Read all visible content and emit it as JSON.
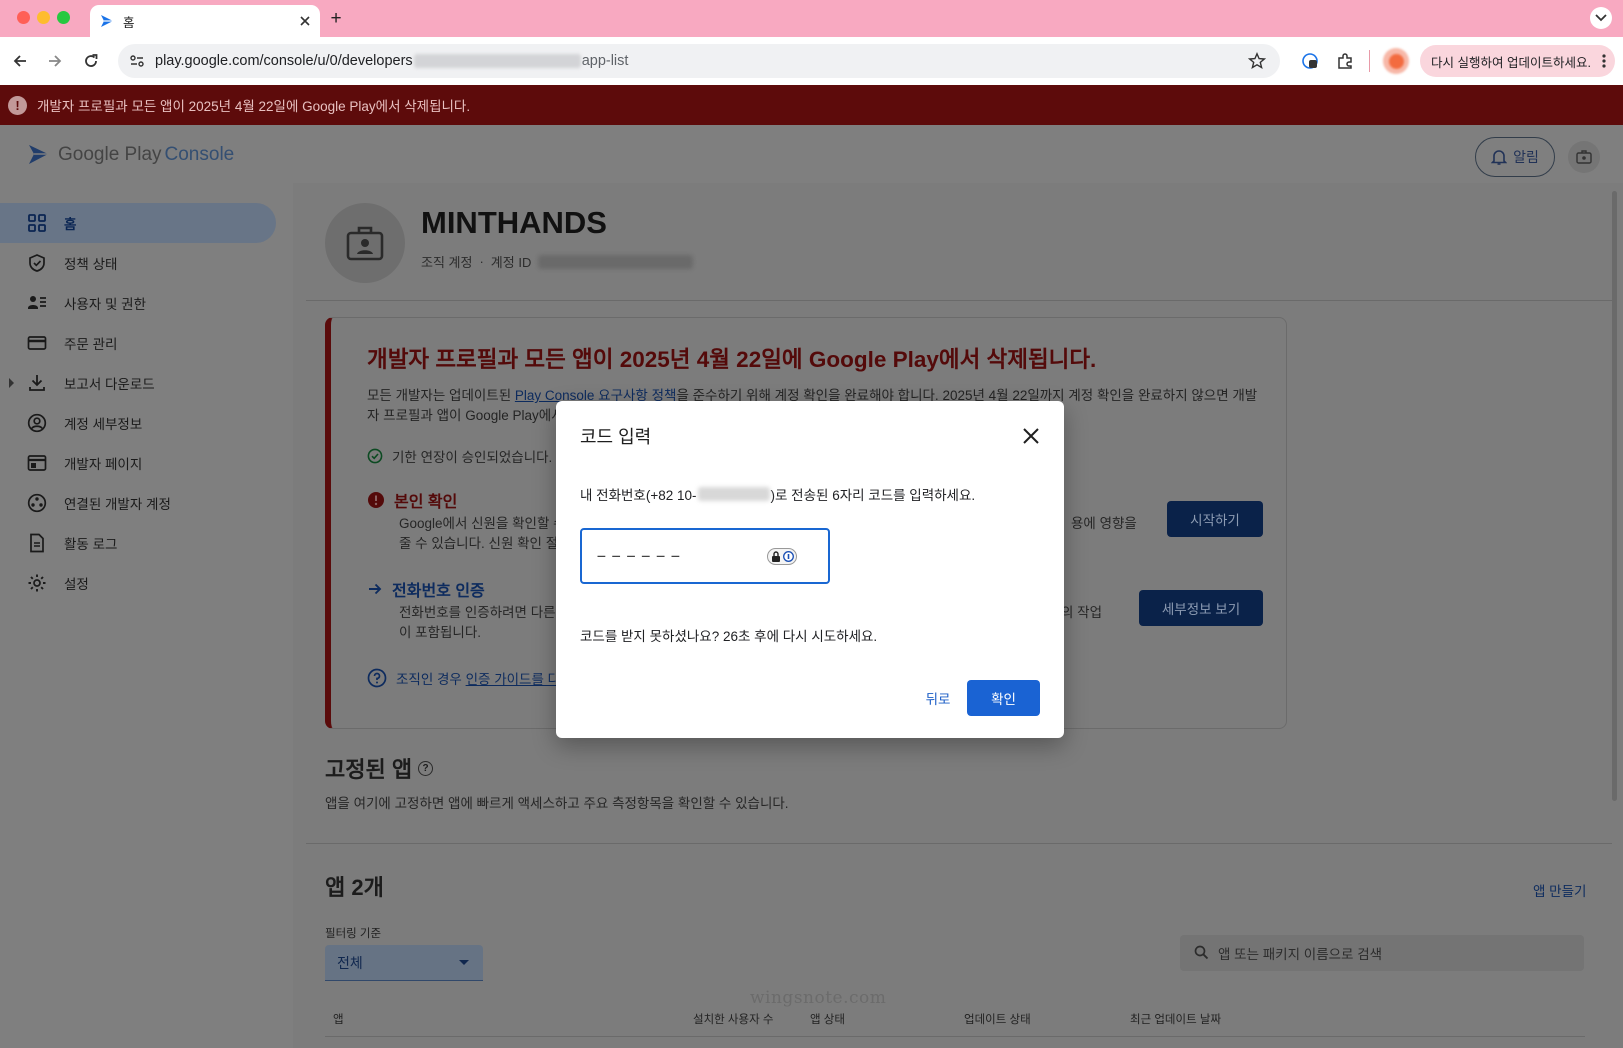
{
  "browser": {
    "tab_title": "홈",
    "new_tab": "+",
    "url_prefix": "play.google.com/console/u/0/developers",
    "url_suffix": "app-list",
    "update_label": "다시 실행하여 업데이트하세요."
  },
  "banner": {
    "text": "개발자 프로필과 모든 앱이 2025년 4월 22일에 Google Play에서 삭제됩니다."
  },
  "header": {
    "logo_google_play": "Google Play",
    "logo_console": "Console",
    "notifications_label": "알림"
  },
  "sidebar": {
    "items": [
      {
        "label": "홈",
        "icon": "dashboard-icon"
      },
      {
        "label": "정책 상태",
        "icon": "shield-icon"
      },
      {
        "label": "사용자 및 권한",
        "icon": "users-icon"
      },
      {
        "label": "주문 관리",
        "icon": "credit-card-icon"
      },
      {
        "label": "보고서 다운로드",
        "icon": "download-icon"
      },
      {
        "label": "계정 세부정보",
        "icon": "account-circle-icon"
      },
      {
        "label": "개발자 페이지",
        "icon": "web-page-icon"
      },
      {
        "label": "연결된 개발자 계정",
        "icon": "linked-accounts-icon"
      },
      {
        "label": "활동 로그",
        "icon": "document-icon"
      },
      {
        "label": "설정",
        "icon": "gear-icon"
      }
    ]
  },
  "account": {
    "name": "MINTHANDS",
    "type": "조직 계정",
    "separator": "·",
    "id_label": "계정 ID"
  },
  "alert": {
    "title": "개발자 프로필과 모든 앱이 2025년 4월 22일에 Google Play에서 삭제됩니다.",
    "body_pre": "모든 개발자는 업데이트된 ",
    "body_link": "Play Console 요구사항 정책",
    "body_post": "을 준수하기 위해 계정 확인을 완료해야 합니다. 2025년 4월 22일까지 계정 확인을 완료하지 않으면 개발자 프로필과 앱이 Google Play에서",
    "extension_text": "기한 연장이 승인되었습니다.",
    "identity_title": "본인 확인",
    "identity_line1": "Google에서 신원을 확인할 수",
    "identity_line1_tail": "용에 영향을",
    "identity_line2": "줄 수 있습니다. 신원 확인 절차",
    "identity_button": "시작하기",
    "phone_title": "전화번호 인증",
    "phone_line1": "전화번호를 인증하려면 다른 ",
    "phone_line1_tail": "의 작업",
    "phone_line2": "이 포함됩니다.",
    "phone_button": "세부정보 보기",
    "org_text": "조직인 경우 ",
    "org_link": "인증 가이드를 다"
  },
  "pinned": {
    "title": "고정된 앱",
    "help": "?",
    "description": "앱을 여기에 고정하면 앱에 빠르게 액세스하고 주요 측정항목을 확인할 수 있습니다."
  },
  "apps": {
    "title": "앱 2개",
    "create_label": "앱 만들기",
    "filter_label": "필터링 기준",
    "filter_value": "전체",
    "search_placeholder": "앱 또는 패키지 이름으로 검색",
    "columns": [
      "앱",
      "설치한 사용자 수",
      "앱 상태",
      "업데이트 상태",
      "최근 업데이트 날짜"
    ]
  },
  "dialog": {
    "title": "코드 입력",
    "desc_pre": "내 전화번호(+82 10-",
    "desc_post": ")로 전송된 6자리 코드를 입력하세요.",
    "code_placeholder": "––––––",
    "code_value": "",
    "resend_text": "코드를 받지 못하셨나요? 26초 후에 다시 시도하세요.",
    "back_label": "뒤로",
    "confirm_label": "확인"
  },
  "watermark": "wingsnote.com",
  "colors": {
    "accent": "#1a63d3",
    "alert_red": "#540a0a",
    "tab_bar": "#f8a9c1"
  }
}
